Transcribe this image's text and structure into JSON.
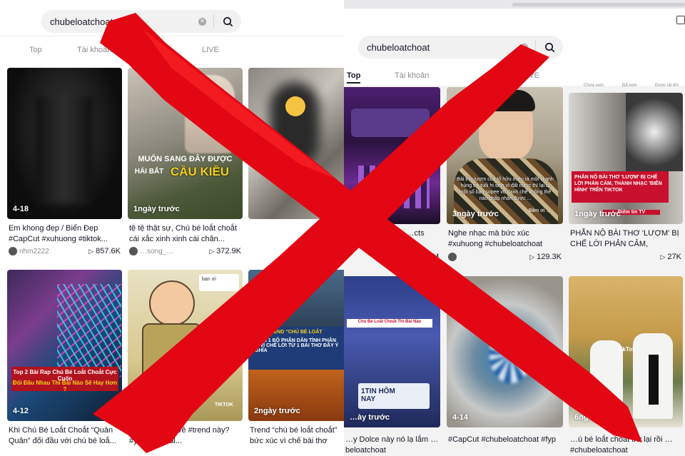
{
  "left": {
    "search": {
      "query": "chubeloatchoat"
    },
    "tabs": [
      {
        "label": "Top",
        "active": false
      },
      {
        "label": "Tài khoản",
        "active": false
      },
      {
        "label": "Video",
        "active": true
      },
      {
        "label": "LIVE",
        "active": false
      }
    ],
    "cards": [
      {
        "badge": "4-18",
        "desc": "Em khong đẹp / Biển Đẹp #CapCut #xuhuong #tiktok...",
        "author": "nhm2222",
        "views": "857.6K"
      },
      {
        "badge": "1ngày trước",
        "desc": "tệ tệ thật sự, Chú bé loắt choắt cái xắc xinh xinh cái chân...",
        "author": "…song_…",
        "views": "372.9K",
        "overlay1": "MUỐN SANG ĐÂY ĐƯỢC",
        "overlay2": "HÁI BẮT",
        "overlay3": "CẦU KIỀU"
      },
      {
        "badge": "",
        "desc": "",
        "author": "",
        "views": ""
      },
      {
        "badge": "4-12",
        "desc": "Khi Chú Bé Loắt Choắt “Quán Quân” đối đầu với chú bé loắ...",
        "author": "",
        "views": "",
        "overlay1": "Top 2 Bài Rap Chú Bé Loắt Choắt Cực Cuốn",
        "overlay2": "Đối Đầu Nhau Thì Bài Nào Sẽ Hay Hơn ?"
      },
      {
        "badge": "1",
        "desc": "Bạn nghĩ sao về #trend này? #yeah1digital...",
        "author": "",
        "views": "",
        "overlay1": "bạn ơi",
        "overlay2": "TIKTOK"
      },
      {
        "badge": "2ngày trước",
        "desc": "Trend “chú bé loắt choắt” bức xúc vì chế bài thơ Lượ...",
        "author": "",
        "views": "",
        "overlay1": "NHẠC TREND “CHÚ BÉ LOẮT CHOẮT”",
        "overlay2": "KHIẾN 1 BỘ PHẬN DÂN TÌNH PHẪN NỘ VÌ CHẾ LỜI TỪ 1 BÀI THƠ ĐẦY Ý NGHĨA"
      }
    ]
  },
  "right": {
    "search": {
      "query": "chubeloatchoat"
    },
    "tabs": [
      {
        "label": "Top",
        "active": true
      },
      {
        "label": "Tài khoản",
        "active": false
      },
      {
        "label": "LIVE",
        "active": false
      }
    ],
    "filter_chips": [
      "Chưa xem",
      "Đã xem",
      "Được tải lên"
    ],
    "cards": [
      {
        "badge": "",
        "desc": "…uốn líu lưỡi 😂 …cts",
        "author": "",
        "views": "1.6M"
      },
      {
        "badge": "3ngày trước",
        "desc": "Nghe nhạc mà bức xúc #xuhuong #chubeloatchoat",
        "author": "",
        "views": "129.3K",
        "overlay1": "Bài thơ lượm của tố hữu miêu tả một vị anh hùng trẻ tuổi hi sinh vì đất nước thì lại bị một số bạn sopee vô danh chế không thể nào chấp nhận được ...",
        "overlay2": "Bâm ơi ..."
      },
      {
        "badge": "1ngày trước",
        "desc": "PHẪN NỘ BÀI THƠ 'LƯỢM' BỊ CHẾ LỜI PHẢN CẢM, THÀNH...",
        "author": "",
        "views": "27K",
        "overlay1": "PHẪN NỘ BÀI THƠ 'LƯỢM' BỊ CHẾ LỜI PHẢN CẢM, THÀNH NHẠC 'BIỂN HÌNH' TRÊN TIKTOK",
        "overlay2": "Điểm tin TV"
      },
      {
        "badge": "…ày trước",
        "desc": "…y Dolce này nó lạ lắm …beloatchoat",
        "author": "",
        "views": "",
        "overlay1": "Chú Bé Loắt Choắt Thì Bài Nào",
        "overlay2": "1TIN HÔM NAY"
      },
      {
        "badge": "4-14",
        "desc": "#CapCut #chubeloatchoat #fyp",
        "author": "",
        "views": ""
      },
      {
        "badge": "6ngày trước",
        "desc": "…ú bé loắt choắt trở lại rồi …#chubeloatchoat",
        "author": "",
        "views": "",
        "overlay1": "TikTok",
        "overlay2": "cần"
      }
    ]
  },
  "colors": {
    "cross": "#e30613",
    "overlay_yellow": "#f5d21a",
    "news_red": "#c8102e"
  }
}
